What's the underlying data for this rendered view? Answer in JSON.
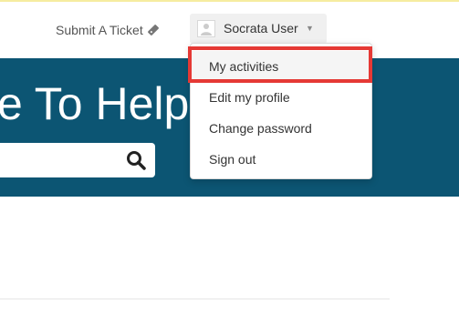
{
  "header": {
    "submit_ticket_label": "Submit A Ticket",
    "ticket_icon": "ticket-icon",
    "user_name": "Socrata User",
    "avatar_icon": "avatar-placeholder-icon",
    "caret_icon": "chevron-down-icon"
  },
  "hero": {
    "title": "e To Help",
    "search_icon": "search-icon"
  },
  "dropdown": {
    "items": [
      {
        "label": "My activities",
        "highlighted": true
      },
      {
        "label": "Edit my profile"
      },
      {
        "label": "Change password"
      },
      {
        "label": "Sign out"
      }
    ]
  },
  "colors": {
    "hero_bg": "#0c5573",
    "highlight": "#e53935",
    "accent_top": "#f6eca0"
  }
}
